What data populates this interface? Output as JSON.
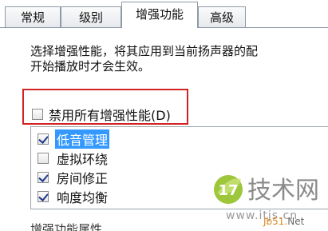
{
  "tabs": [
    {
      "label": "常规",
      "active": false
    },
    {
      "label": "级别",
      "active": false
    },
    {
      "label": "增强功能",
      "active": true
    },
    {
      "label": "高级",
      "active": false
    }
  ],
  "description": {
    "line1": "选择增强性能，将其应用到当前扬声器的配",
    "line2": "开始播放时才会生效。"
  },
  "disable_all": {
    "label": "禁用所有增强性能(D)",
    "checked": false
  },
  "enhancements": [
    {
      "label": "低音管理",
      "checked": true,
      "selected": true
    },
    {
      "label": "虚拟环绕",
      "checked": false,
      "selected": false
    },
    {
      "label": "房间修正",
      "checked": true,
      "selected": false
    },
    {
      "label": "响度均衡",
      "checked": true,
      "selected": false
    }
  ],
  "section_below": {
    "label": "增强功能属性"
  },
  "watermark": {
    "logo_number": "17",
    "logo_text": "技术网",
    "url": "www.itjs.cn",
    "url_b_prefix": "Jb51",
    "url_b_net": "Net",
    "colors": {
      "green": "#9dc63b",
      "text_gray": "#8a8a8a"
    }
  }
}
